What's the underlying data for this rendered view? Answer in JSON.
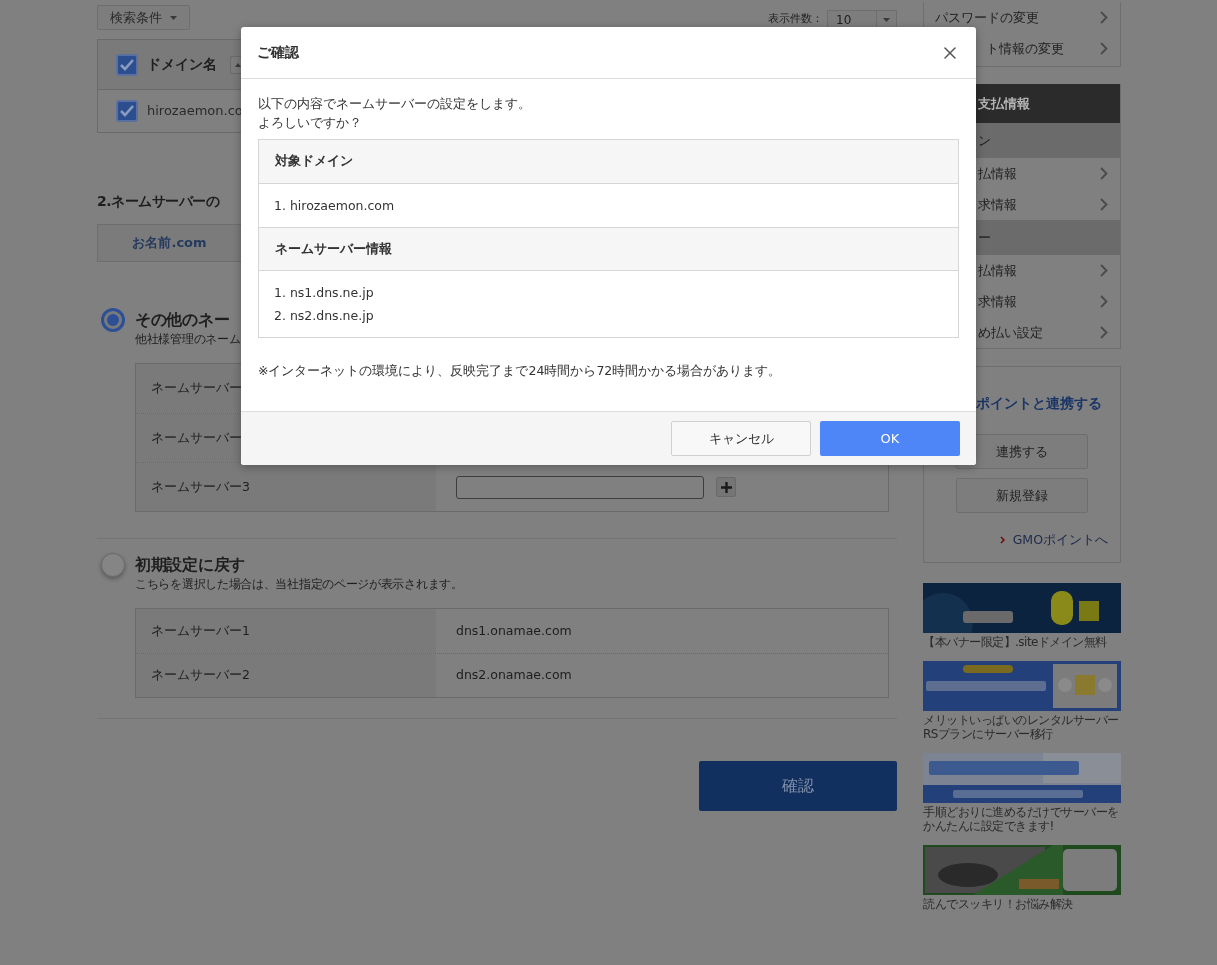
{
  "search_filter_button": "検索条件",
  "page_size": {
    "label": "表示件数：",
    "value": "10"
  },
  "domain_table": {
    "header": {
      "label": "ドメイン名",
      "checked": true
    },
    "rows": [
      {
        "domain": "hirozaemon.co",
        "checked": true
      }
    ]
  },
  "section_heading": "2.ネームサーバーの",
  "server_tab": {
    "label": "お名前.com"
  },
  "options": [
    {
      "title": "その他のネー",
      "description": "他社様管理のネーム",
      "selected": true,
      "rows": [
        {
          "kind": "covered",
          "label": "ネームサーバー"
        },
        {
          "kind": "covered",
          "label": "ネームサーバー"
        },
        {
          "kind": "input",
          "label": "ネームサーバー3"
        }
      ]
    },
    {
      "title": "初期設定に戻す",
      "description": "こちらを選択した場合は、当社指定のページが表示されます。",
      "selected": false,
      "rows": [
        {
          "kind": "text",
          "label": "ネームサーバー1",
          "value": "dns1.onamae.com"
        },
        {
          "kind": "text",
          "label": "ネームサーバー2",
          "value": "dns2.onamae.com"
        }
      ]
    }
  ],
  "confirm_button": "確認",
  "sidebar": {
    "account_links": [
      "パスワードの変更",
      "ト情報の変更"
    ],
    "payment": {
      "title": "支払情報",
      "groups": [
        {
          "label": "ン",
          "items": [
            "払情報",
            "求情報"
          ]
        },
        {
          "label": "ー",
          "items": [
            "払情報",
            "求情報",
            "め払い設定"
          ]
        }
      ]
    },
    "gmo": {
      "title": "ポイントと連携する",
      "buttons": [
        "連携する",
        "新規登録"
      ],
      "link": "GMOポイントへ"
    },
    "banners": [
      {
        "kind": "picture",
        "caption": "【本バナー限定】.siteドメイン無料"
      },
      {
        "kind": "picture",
        "caption": "メリットいっぱいのレンタルサーバーRSプランにサーバー移行"
      },
      {
        "kind": "picture",
        "caption": "手順どおりに進めるだけでサーバーをかんたんに設定できます!"
      },
      {
        "kind": "picture",
        "caption": "読んでスッキリ！お悩み解決"
      }
    ]
  },
  "modal": {
    "title": "ご確認",
    "message": [
      "以下の内容でネームサーバーの設定をします。",
      "よろしいですか？"
    ],
    "sections": [
      {
        "heading": "対象ドメイン",
        "items": [
          "1. hirozaemon.com"
        ]
      },
      {
        "heading": "ネームサーバー情報",
        "items": [
          "1. ns1.dns.ne.jp",
          "2. ns2.dns.ne.jp"
        ]
      }
    ],
    "note": "※インターネットの環境により、反映完了まで24時間から72時間かかる場合があります。",
    "buttons": [
      {
        "label": "キャンセル",
        "kind": "secondary"
      },
      {
        "label": "OK",
        "kind": "primary"
      }
    ]
  }
}
